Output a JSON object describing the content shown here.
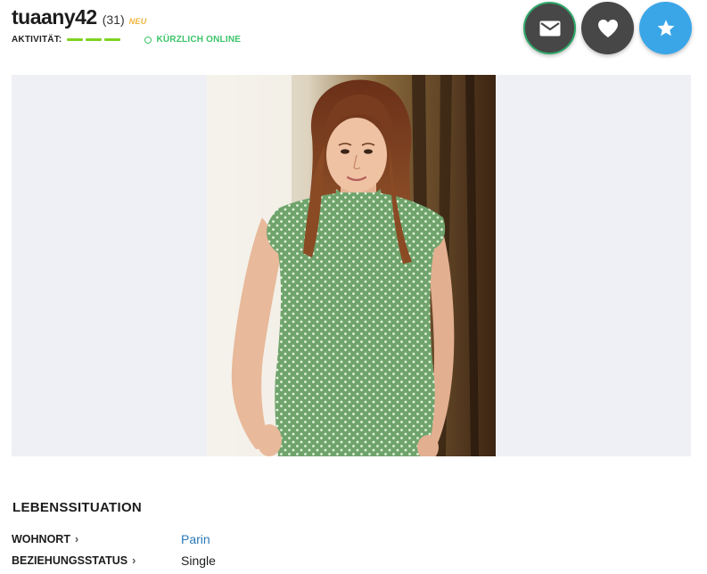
{
  "profile": {
    "username": "tuaany42",
    "age": "(31)",
    "badge": "NEU",
    "activity_label": "AKTIVITÄT:",
    "activity_level": 3,
    "online_status": "KÜRZLICH ONLINE"
  },
  "actions": [
    {
      "name": "message",
      "icon": "envelope-icon"
    },
    {
      "name": "like",
      "icon": "heart-icon"
    },
    {
      "name": "favorite",
      "icon": "star-icon"
    }
  ],
  "colors": {
    "activity": "#7ed321",
    "online": "#3cc46a",
    "badge": "#f0b43c",
    "favorite_button": "#3aa6e8",
    "dark_button": "#474747",
    "link": "#2a78b8"
  },
  "section": {
    "title": "LEBENSSITUATION",
    "rows": [
      {
        "label": "WOHNORT",
        "chevron": "›",
        "value": "Parin"
      },
      {
        "label": "BEZIEHUNGSSTATUS",
        "chevron": "›",
        "value": "Single"
      }
    ]
  }
}
